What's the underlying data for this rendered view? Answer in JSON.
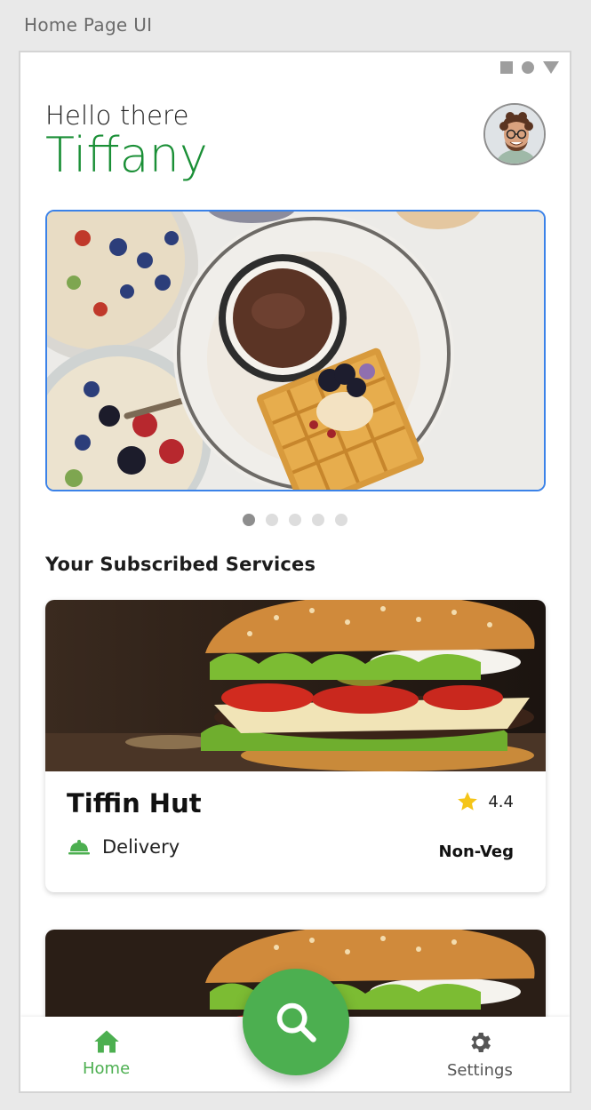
{
  "frame": {
    "title": "Home Page UI"
  },
  "header": {
    "greeting": "Hello there",
    "user_name": "Tiffany"
  },
  "carousel": {
    "slide_count": 5,
    "active_index": 0
  },
  "section": {
    "title": "Your Subscribed Services"
  },
  "services": [
    {
      "name": "Tiffin Hut",
      "rating": "4.4",
      "service_type": "Delivery",
      "food_type": "Non-Veg"
    }
  ],
  "nav": {
    "home_label": "Home",
    "settings_label": "Settings"
  },
  "colors": {
    "brand_green": "#4caf50",
    "name_green": "#1a8f36",
    "banner_border": "#3b82e8",
    "star": "#f5c518"
  },
  "icons": {
    "home": "home-icon",
    "settings": "gear-icon",
    "search": "search-icon",
    "delivery": "cloche-icon",
    "rating": "star-icon"
  }
}
